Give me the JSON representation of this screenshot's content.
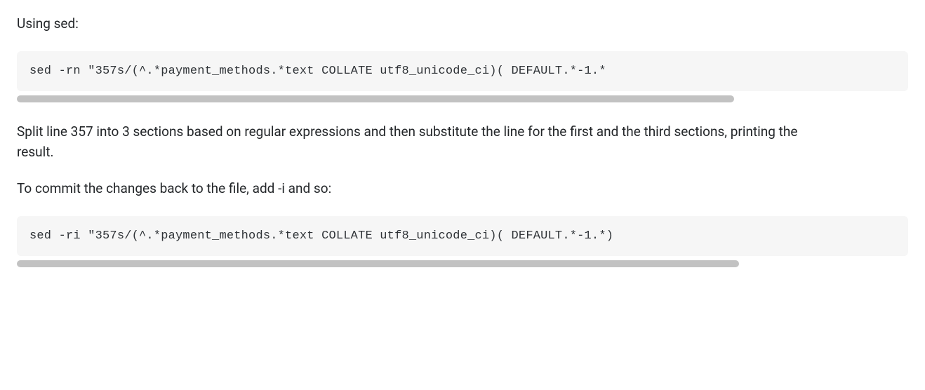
{
  "intro": "Using sed:",
  "code1": "sed -rn \"357s/(^.*payment_methods.*text COLLATE utf8_unicode_ci)( DEFAULT.*-1.*",
  "explanation": "Split line 357 into 3 sections based on regular expressions and then substitute the line for the first and the third sections, printing the result.",
  "commit_text": "To commit the changes back to the file, add -i and so:",
  "code2": "sed -ri \"357s/(^.*payment_methods.*text COLLATE utf8_unicode_ci)( DEFAULT.*-1.*)"
}
